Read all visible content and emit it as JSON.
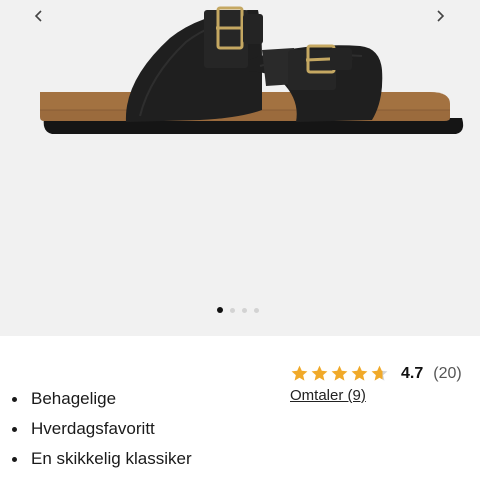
{
  "gallery": {
    "image_name": "black-two-strap-buckle-sandal",
    "prev_icon": "chevron-left-icon",
    "next_icon": "chevron-right-icon",
    "slide_count": 4,
    "active_slide": 1
  },
  "rating": {
    "stars_icon": "star-icon",
    "value": "4.7",
    "value_fraction": 0.94,
    "count": "(20)",
    "star_color": "#f0a929",
    "empty_star_color": "#d4d4d4",
    "reviews_link": "Omtaler (9)"
  },
  "features": [
    {
      "label": "Behagelige"
    },
    {
      "label": "Hverdagsfavoritt"
    },
    {
      "label": "En skikkelig klassiker"
    }
  ]
}
